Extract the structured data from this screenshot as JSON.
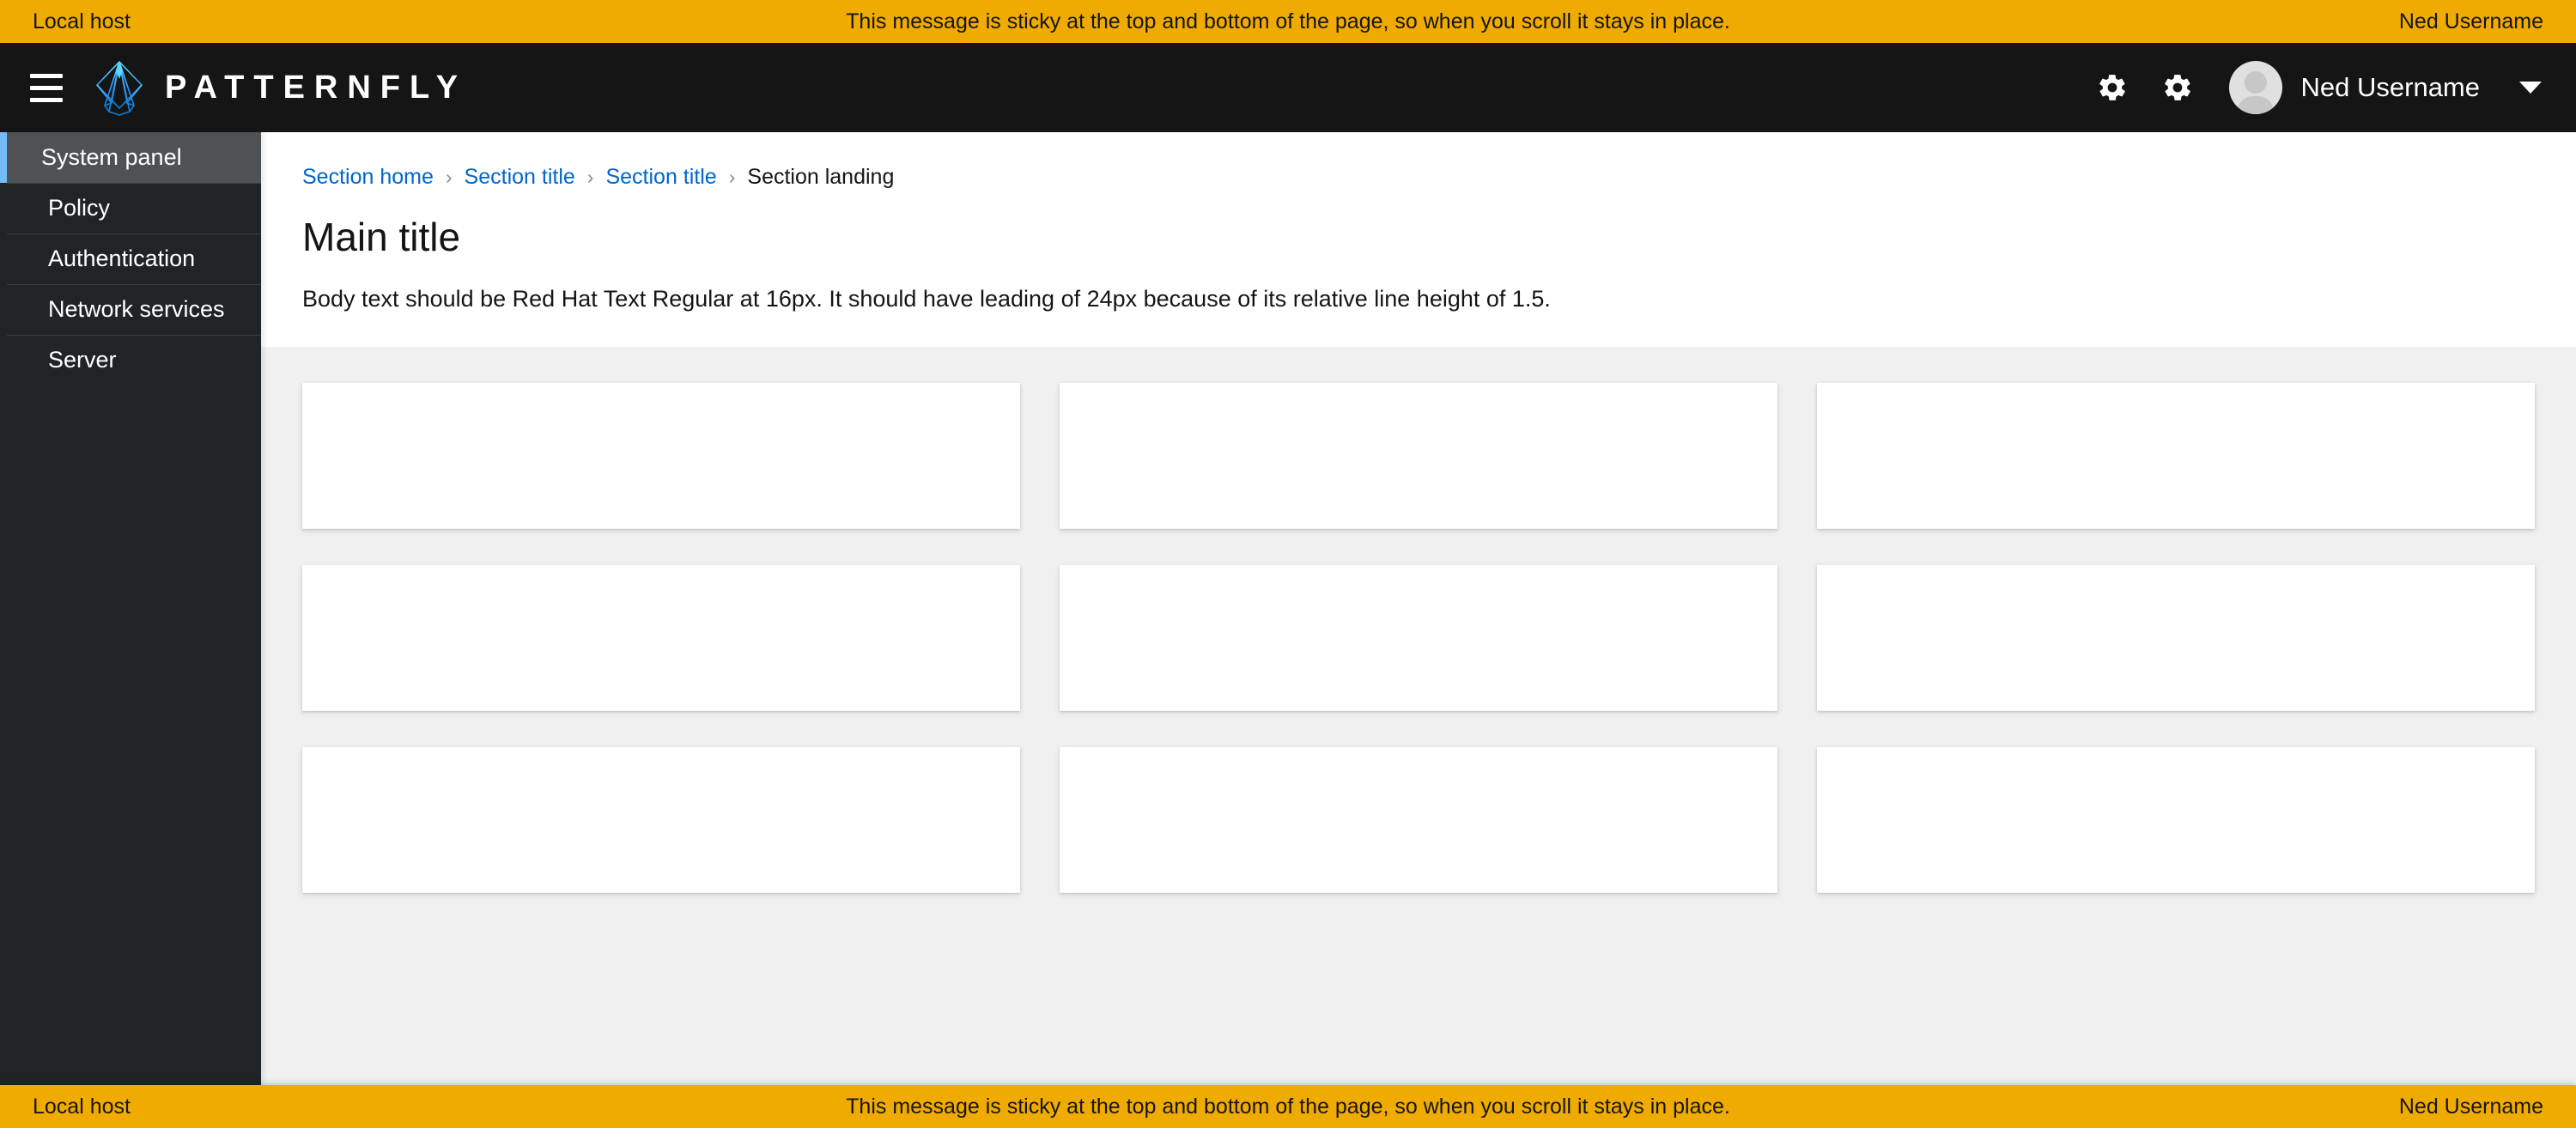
{
  "banner": {
    "left_label": "Local host",
    "message": "This message is sticky at the top and bottom of the page, so when you scroll it stays in place.",
    "right_label": "Ned Username",
    "background_color": "#f0ab00",
    "text_color": "#151515"
  },
  "masthead": {
    "menu_icon": "hamburger-menu-icon",
    "brand_name": "PATTERNFLY",
    "brand_logo_icon": "patternfly-diamond-logo-icon",
    "brand_logo_color": "#2b9af3",
    "background_color": "#151515",
    "actions": [
      {
        "icon": "gear-icon",
        "label": "Settings"
      },
      {
        "icon": "gear-icon",
        "label": "Settings"
      }
    ],
    "user": {
      "name": "Ned Username",
      "avatar_icon": "avatar-icon",
      "dropdown_icon": "caret-down-icon"
    }
  },
  "sidebar": {
    "background_color": "#212427",
    "active_indicator_color": "#73bcf7",
    "active_background_color": "#4f5255",
    "items": [
      {
        "label": "System panel",
        "active": true
      },
      {
        "label": "Policy",
        "active": false
      },
      {
        "label": "Authentication",
        "active": false
      },
      {
        "label": "Network services",
        "active": false
      },
      {
        "label": "Server",
        "active": false
      }
    ]
  },
  "content": {
    "breadcrumb": {
      "separator": "›",
      "items": [
        {
          "label": "Section home",
          "current": false
        },
        {
          "label": "Section title",
          "current": false
        },
        {
          "label": "Section title",
          "current": false
        },
        {
          "label": "Section landing",
          "current": true
        }
      ],
      "link_color": "#06c"
    },
    "title": "Main title",
    "body_text": "Body text should be Red Hat Text Regular at 16px. It should have leading of 24px because of its relative line height of 1.5.",
    "cards_section": {
      "background_color": "#f0f0f0",
      "columns": 3,
      "cards": [
        {
          "id": "card-1"
        },
        {
          "id": "card-2"
        },
        {
          "id": "card-3"
        },
        {
          "id": "card-4"
        },
        {
          "id": "card-5"
        },
        {
          "id": "card-6"
        },
        {
          "id": "card-7"
        },
        {
          "id": "card-8"
        },
        {
          "id": "card-9"
        }
      ]
    }
  }
}
